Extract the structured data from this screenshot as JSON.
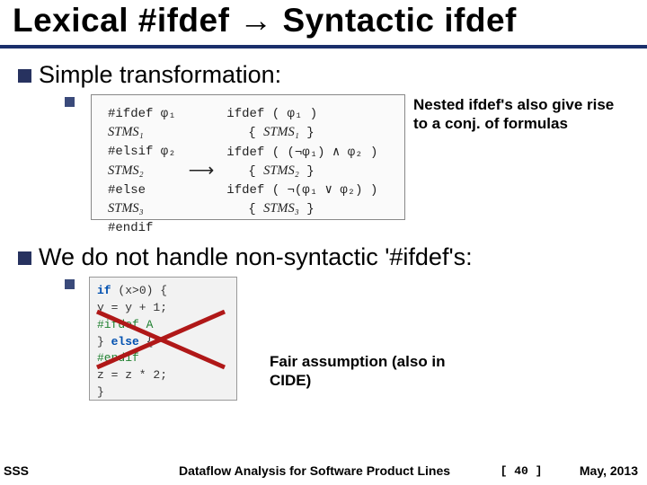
{
  "title": "Lexical #ifdef → Syntactic ifdef",
  "bullets": {
    "b1": "Simple transformation:",
    "b2": "We do not handle non-syntactic '#ifdef's:"
  },
  "transform": {
    "left": {
      "l1": "#ifdef φ₁",
      "l2": "STMS₁",
      "l3": "#elsif φ₂",
      "l4": "STMS₂",
      "l5": "#else",
      "l6": "STMS₃",
      "l7": "#endif"
    },
    "arrow": "⟶",
    "right": {
      "r1": "ifdef ( φ₁ )",
      "r2": "{ STMS₁ }",
      "r3": "ifdef ( (¬φ₁) ∧ φ₂ )",
      "r4": "{ STMS₂ }",
      "r5": "ifdef ( ¬(φ₁ ∨ φ₂) )",
      "r6": "{ STMS₃ }"
    }
  },
  "note1": "Nested ifdef's also give rise to a conj. of formulas",
  "code2": {
    "l1_a": "if",
    "l1_b": " (x>0) {",
    "l2": "   y = y + 1;",
    "l3": "#ifdef A",
    "l4_a": "} ",
    "l4_b": "else",
    "l4_c": " {",
    "l5": "#endif",
    "l6": "   z = z * 2;",
    "l7": "}"
  },
  "note2": "Fair assumption (also in CIDE)",
  "footer": {
    "left": "SSS",
    "center": "Dataflow Analysis for Software Product Lines",
    "page": "[ 40 ]",
    "right": "May, 2013"
  }
}
